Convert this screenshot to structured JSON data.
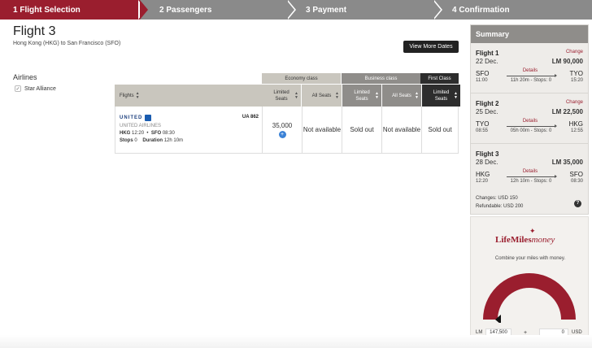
{
  "steps": [
    {
      "label": "1 Flight Selection"
    },
    {
      "label": "2 Passengers"
    },
    {
      "label": "3 Payment"
    },
    {
      "label": "4 Confirmation"
    }
  ],
  "header": {
    "title": "Flight 3",
    "route": "Hong Kong (HKG) to San Francisco (SFO)",
    "more_dates_label": "View More Dates"
  },
  "filters": {
    "heading": "Airlines",
    "items": [
      {
        "label": "Star Alliance",
        "checked": true
      }
    ]
  },
  "table": {
    "class_headers": {
      "economy": "Economy class",
      "business": "Business class",
      "first": "First Class"
    },
    "sub_headers": {
      "flights": "Flights",
      "econ_limited": "Limited Seats",
      "econ_all": "All Seats",
      "bus_limited": "Limited Seats",
      "bus_all": "All Seats",
      "first_limited": "Limited Seats"
    },
    "rows": [
      {
        "airline_logo_text": "UNITED",
        "flight_no": "UA 862",
        "airline_name": "UNITED AIRLINES",
        "dep_code": "HKG",
        "dep_time": "12:20",
        "arr_code": "SFO",
        "arr_time": "08:30",
        "stops_label": "Stops",
        "stops": "0",
        "duration_label": "Duration",
        "duration": "12h 10m",
        "econ_limited": "35,000",
        "econ_all": "Not available",
        "bus_limited": "Sold out",
        "bus_all": "Not available",
        "first_limited": "Sold out"
      }
    ]
  },
  "summary": {
    "title": "Summary",
    "legs": [
      {
        "title": "Flight 1",
        "change": "Change",
        "date": "22 Dec.",
        "miles": "LM 90,000",
        "from": "SFO",
        "to": "TYO",
        "from_time": "11:00",
        "to_time": "15:20",
        "details": "Details",
        "duration": "11h 20m - Stops: 0"
      },
      {
        "title": "Flight 2",
        "change": "Change",
        "date": "25 Dec.",
        "miles": "LM 22,500",
        "from": "TYO",
        "to": "HKG",
        "from_time": "08:55",
        "to_time": "12:55",
        "details": "Details",
        "duration": "05h 00m - Stops: 0"
      },
      {
        "title": "Flight 3",
        "change": "",
        "date": "28 Dec.",
        "miles": "LM 35,000",
        "from": "HKG",
        "to": "SFO",
        "from_time": "12:20",
        "to_time": "08:30",
        "details": "Details",
        "duration": "12h 10m - Stops: 0"
      }
    ],
    "changes": "Changes: USD 150",
    "refundable": "Refundable: USD 200"
  },
  "lifemiles": {
    "logo_main": "LifeMiles",
    "logo_money": "money",
    "subtitle": "Combine your miles with money.",
    "currency_lm": "LM",
    "miles_value": "147,500",
    "plus": "+",
    "cash_value": "0",
    "currency_usd": "USD",
    "gauge_fraction": 1.0
  },
  "colors": {
    "brand": "#9a1e2e",
    "step_inactive": "#8a8a8a",
    "link_blue": "#3b82d6"
  }
}
